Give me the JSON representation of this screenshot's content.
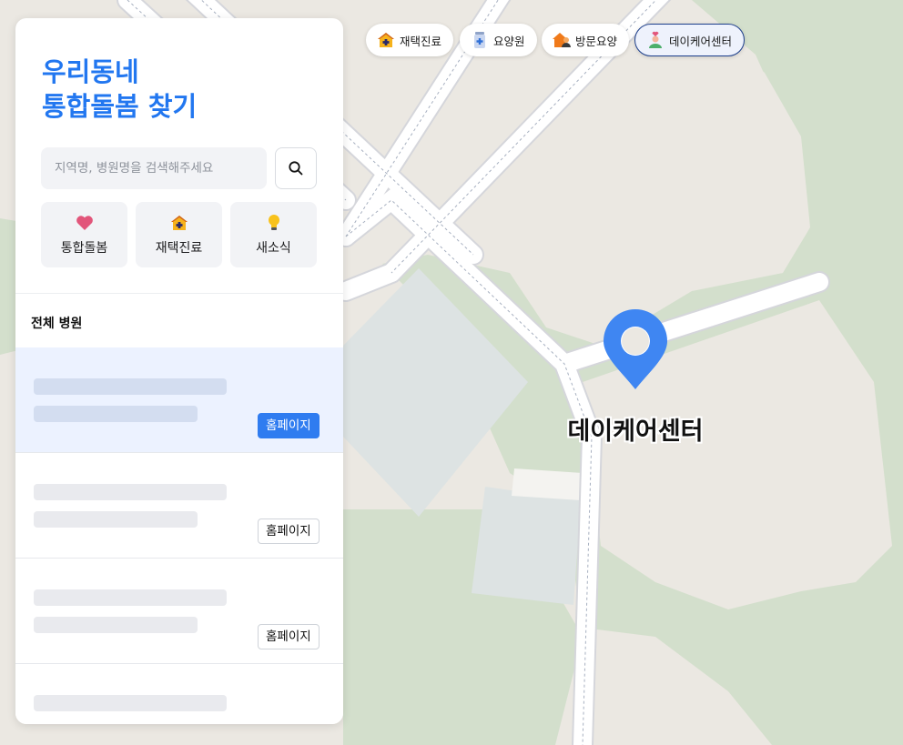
{
  "panel": {
    "title_line1": "우리동네",
    "title_line2": "통합돌봄 찾기",
    "search": {
      "placeholder": "지역명, 병원명을 검색해주세요",
      "value": ""
    },
    "search_icon": "search-icon",
    "quick_links": [
      {
        "label": "통합돌봄",
        "icon": "heart-icon"
      },
      {
        "label": "재택진료",
        "icon": "house-medical-icon"
      },
      {
        "label": "새소식",
        "icon": "lightbulb-icon"
      }
    ],
    "list_title": "전체 병원",
    "items": [
      {
        "button_label": "홈페이지",
        "selected": true
      },
      {
        "button_label": "홈페이지",
        "selected": false
      },
      {
        "button_label": "홈페이지",
        "selected": false
      },
      {
        "button_label": "",
        "selected": false
      }
    ]
  },
  "filters": [
    {
      "label": "재택진료",
      "icon": "house-medical-icon",
      "selected": false
    },
    {
      "label": "요양원",
      "icon": "medicine-bottle-icon",
      "selected": false
    },
    {
      "label": "방문요양",
      "icon": "home-visit-icon",
      "selected": false
    },
    {
      "label": "데이케어센터",
      "icon": "daycare-person-icon",
      "selected": true
    }
  ],
  "map": {
    "marker_label": "데이케어센터",
    "marker_color": "#3f86f2",
    "accent_color": "#2277f0",
    "chip_selected_border": "#1d3f8c"
  }
}
